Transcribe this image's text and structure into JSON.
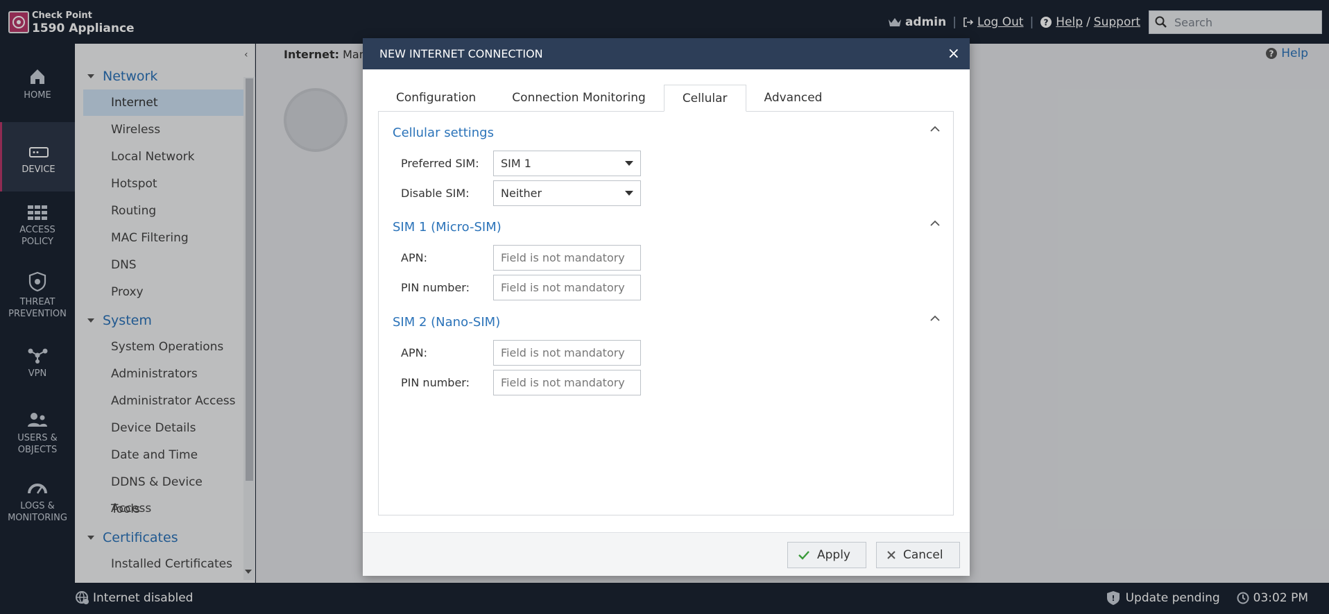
{
  "brand": {
    "company": "Check Point",
    "product": "1590 Appliance"
  },
  "topbar": {
    "user": "admin",
    "logout": "Log Out",
    "help": "Help",
    "slash": "/",
    "support": "Support",
    "search_placeholder": "Search",
    "separator": "|"
  },
  "leftnav": [
    {
      "label": "HOME",
      "icon": "home-icon"
    },
    {
      "label": "DEVICE",
      "icon": "device-icon",
      "active": true
    },
    {
      "label_1": "ACCESS",
      "label_2": "POLICY",
      "icon": "access-policy-icon"
    },
    {
      "label_1": "THREAT",
      "label_2": "PREVENTION",
      "icon": "threat-prevention-icon"
    },
    {
      "label": "VPN",
      "icon": "vpn-icon"
    },
    {
      "label_1": "USERS &",
      "label_2": "OBJECTS",
      "icon": "users-objects-icon"
    },
    {
      "label_1": "LOGS &",
      "label_2": "MONITORING",
      "icon": "logs-monitoring-icon"
    }
  ],
  "menu": {
    "collapse": "‹",
    "sections": [
      "Network",
      "System",
      "Certificates"
    ],
    "network_items": [
      "Internet",
      "Wireless",
      "Local Network",
      "Hotspot",
      "Routing",
      "MAC Filtering",
      "DNS",
      "Proxy"
    ],
    "system_items": [
      "System Operations",
      "Administrators",
      "Administrator Access",
      "Device Details",
      "Date and Time",
      "DDNS & Device Access",
      "Tools"
    ],
    "certificate_items": [
      "Installed Certificates"
    ]
  },
  "content": {
    "crumb_bold": "Internet:",
    "crumb_rest": " Mana",
    "help": "Help"
  },
  "dialog": {
    "title": "NEW INTERNET CONNECTION",
    "close": "×",
    "tabs": [
      "Configuration",
      "Connection Monitoring",
      "Cellular",
      "Advanced"
    ],
    "active_tab": "Cellular",
    "cellular": {
      "title": "Cellular settings",
      "preferred_label": "Preferred SIM:",
      "preferred_value": "SIM 1",
      "disable_label": "Disable SIM:",
      "disable_value": "Neither"
    },
    "sim1": {
      "title": "SIM 1 (Micro-SIM)",
      "apn_label": "APN:",
      "pin_label": "PIN number:",
      "placeholder": "Field is not mandatory"
    },
    "sim2": {
      "title": "SIM 2 (Nano-SIM)",
      "apn_label": "APN:",
      "pin_label": "PIN number:",
      "placeholder": "Field is not mandatory"
    },
    "apply": "Apply",
    "cancel": "Cancel"
  },
  "status": {
    "internet": "Internet disabled",
    "update": "Update pending",
    "time": "03:02 PM"
  },
  "colors": {
    "accent": "#2b73b9",
    "brand": "#b8386a",
    "header": "#2d3e58",
    "dark": "#1c2533"
  }
}
